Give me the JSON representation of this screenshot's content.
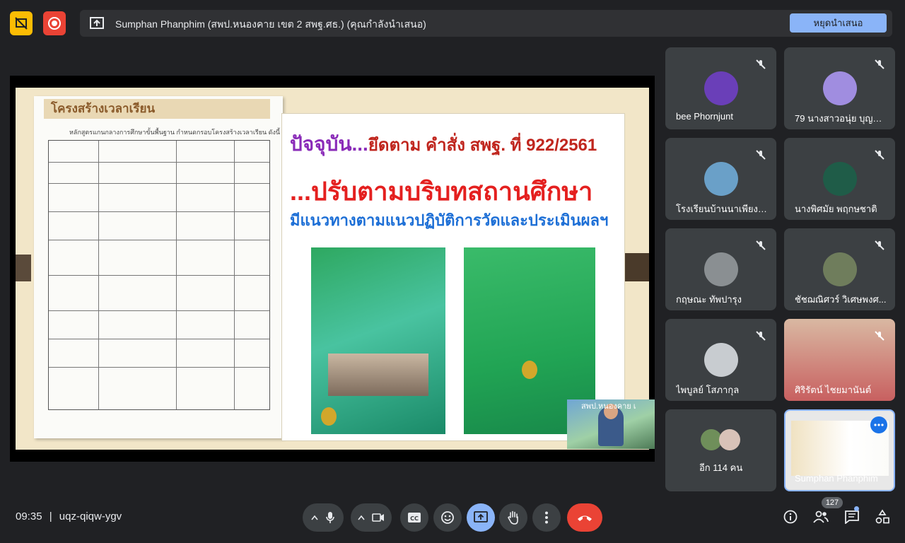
{
  "top_bar": {
    "presenter_banner": "Sumphan Phanphim (สพป.หนองคาย เขต 2 สพฐ.ศธ.) (คุณกำลังนำเสนอ)",
    "stop_presenting_label": "หยุดนำเสนอ"
  },
  "slide": {
    "doc_title": "โครงสร้างเวลาเรียน",
    "doc_subtitle": "หลักสูตรแกนกลางการศึกษาขั้นพื้นฐาน กำหนดกรอบโครงสร้างเวลาเรียน ดังนี้",
    "headline_1a": "ปัจจุบัน...",
    "headline_1b": "ยึดตาม คำสั่ง สพฐ. ที่ 922/2561",
    "headline_2": "...ปรับตามบริบทสถานศึกษา",
    "headline_3": "มีแนวทางตามแนวปฏิบัติการวัดและประเมินผลฯ",
    "pip_caption": "สพป.หนองคาย เ"
  },
  "participants": [
    {
      "name": "bee Phornjunt",
      "muted": true,
      "avatar_color": "#6a3fb8"
    },
    {
      "name": "79 นางสาวอนุ่ย บุญญ...",
      "muted": true,
      "avatar_color": "#a08de0"
    },
    {
      "name": "โรงเรียนบ้านนาเพียงน้...",
      "muted": true,
      "avatar_color": "#6aa0c8"
    },
    {
      "name": "นางพิศมัย พฤกษชาติ",
      "muted": true,
      "avatar_color": "#1f5c48"
    },
    {
      "name": "กฤษณะ ทัพปารุง",
      "muted": true,
      "avatar_color": "#8a8f92"
    },
    {
      "name": "ชัชฌณิศวร์ วิเศษพงศ...",
      "muted": true,
      "avatar_color": "#6f7d5c"
    },
    {
      "name": "ไพบูลย์ โสภากุล",
      "muted": true,
      "avatar_color": "#c8ccd0"
    },
    {
      "name": "ศิริรัตน์ ไชยมานันต์",
      "muted": true,
      "avatar_color": "#d9b8a2"
    },
    {
      "name": "อีก 114 คน",
      "muted": false,
      "avatar_color": "#3c4043"
    },
    {
      "name": "Sumphan Phanphim",
      "muted": false,
      "avatar_color": "#8ab4f8"
    }
  ],
  "bottom_bar": {
    "time": "09:35",
    "separator": "|",
    "meeting_code": "uqz-qiqw-ygv",
    "people_count": "127",
    "end_call_color": "#ea4335",
    "present_color": "#8ab4f8"
  },
  "icons": [
    "no-camera-icon",
    "record-icon",
    "present-screen-icon",
    "mic-icon",
    "camera-icon",
    "captions-icon",
    "emoji-icon",
    "present-icon",
    "raise-hand-icon",
    "more-icon",
    "end-call-icon",
    "info-icon",
    "people-icon",
    "chat-icon",
    "activities-icon",
    "mic-off-icon"
  ]
}
